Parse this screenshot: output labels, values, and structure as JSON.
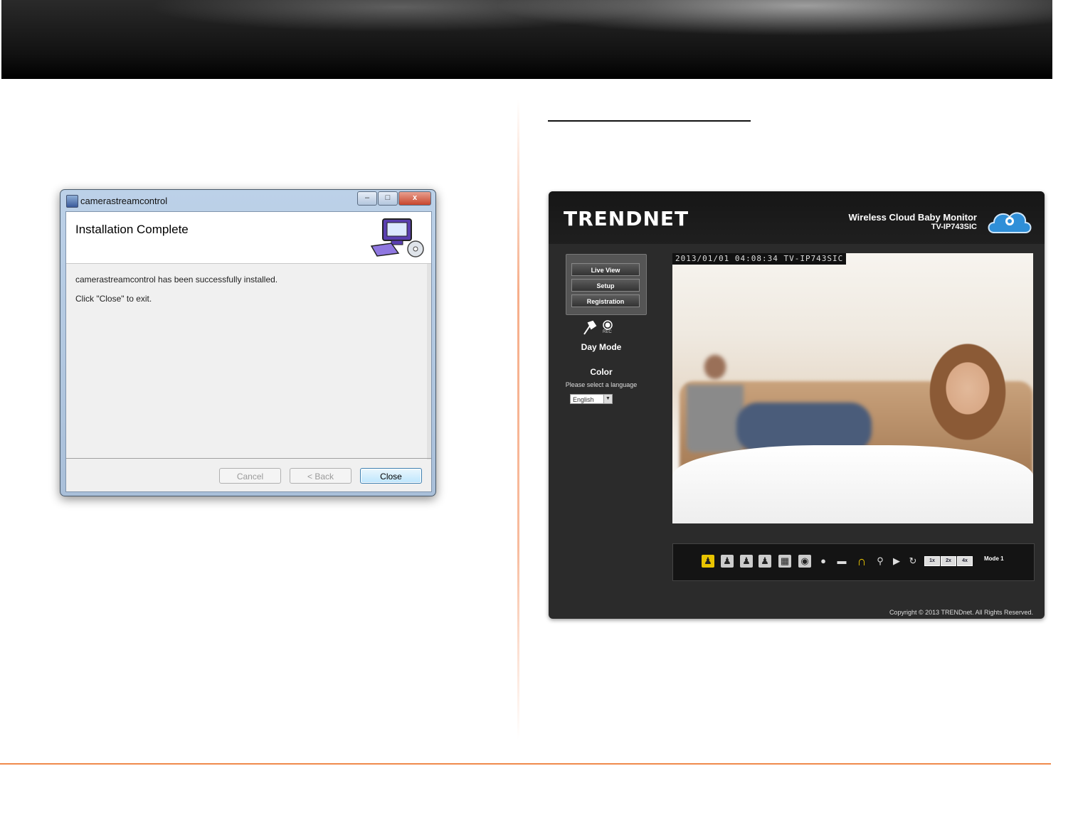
{
  "dialog": {
    "window_title": "camerastreamcontrol",
    "heading": "Installation Complete",
    "message_line1": "camerastreamcontrol has been successfully installed.",
    "message_line2": "Click \"Close\" to exit.",
    "buttons": {
      "cancel": "Cancel",
      "back": "< Back",
      "close": "Close"
    },
    "titlebar_buttons": {
      "minimize": "–",
      "maximize": "□",
      "close": "x"
    }
  },
  "webui": {
    "brand": "TRENDNET",
    "product_name": "Wireless Cloud Baby Monitor",
    "model": "TV-IP743SIC",
    "menu": {
      "live_view": "Live View",
      "setup": "Setup",
      "registration": "Registration"
    },
    "rec_label": "REC",
    "day_mode": "Day Mode",
    "color": "Color",
    "language_prompt": "Please select a language",
    "language_value": "English",
    "timestamp": "2013/01/01 04:08:34 TV-IP743SIC",
    "layout_buttons": [
      "1x",
      "2x",
      "4x"
    ],
    "mode_label": "Mode 1",
    "copyright": "Copyright © 2013 TRENDnet. All Rights Reserved.",
    "cloud_label": "TRENDnet Cloud"
  },
  "colors": {
    "accent_orange": "#f08a4b",
    "dialog_primary": "#3c7fb1",
    "camera_bg": "#2b2b2b"
  }
}
